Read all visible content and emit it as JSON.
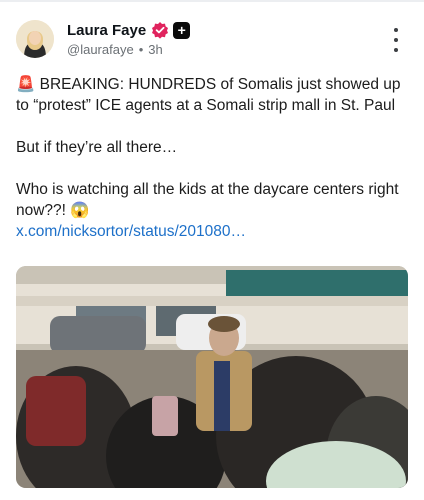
{
  "author": {
    "display_name": "Laura Faye",
    "handle": "@laurafaye",
    "time": "3h",
    "separator": "•",
    "verified_icon": "verified-badge-icon",
    "plus_icon": "plus-icon"
  },
  "post": {
    "line1": "🚨 BREAKING: HUNDREDS of Somalis just showed up to “protest” ICE agents at a Somali strip mall in St. Paul",
    "line2": "But if they’re all there…",
    "line3": "Who is watching all the kids at the daycare centers right now??! 😱",
    "link": "x.com/nicksortor/status/201080…"
  },
  "colors": {
    "link": "#1d70c9",
    "badge": "#e0245e"
  }
}
